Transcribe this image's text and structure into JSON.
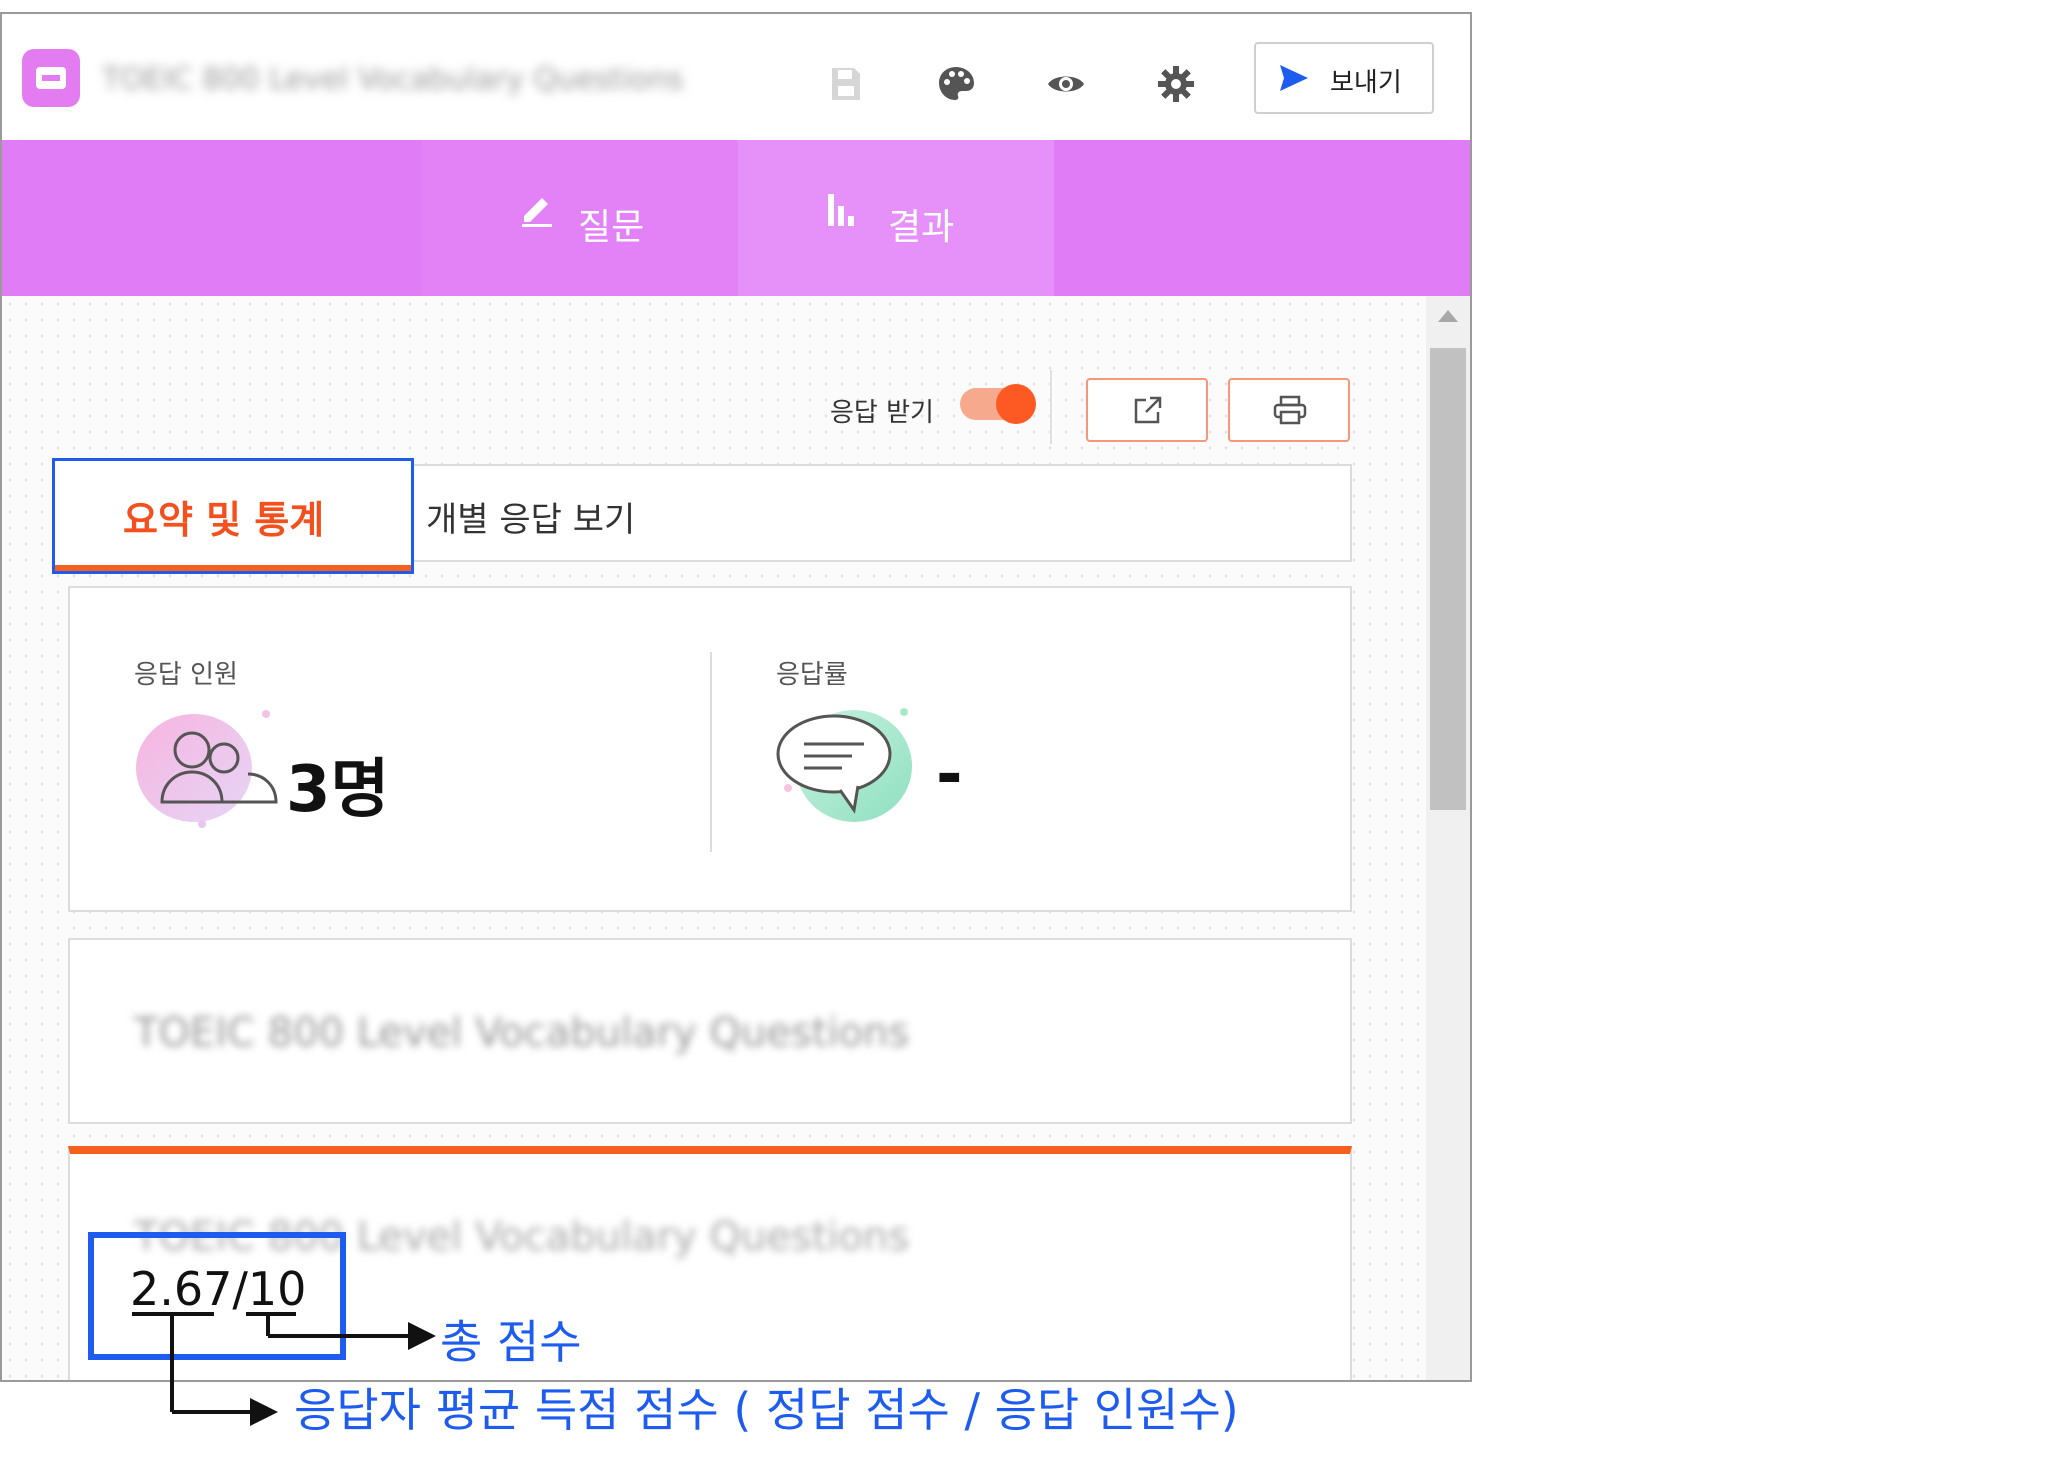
{
  "header": {
    "document_title": "TOEIC 800 Level Vocabulary Questions",
    "send_label": "보내기",
    "icons": [
      "save-icon",
      "palette-icon",
      "eye-icon",
      "gear-icon",
      "send-icon"
    ]
  },
  "tabs": [
    {
      "label": "질문",
      "icon": "pencil-icon"
    },
    {
      "label": "결과",
      "icon": "bar-chart-icon",
      "selected": true
    }
  ],
  "results": {
    "accept_responses_label": "응답 받기",
    "accept_responses_on": true,
    "subtabs": [
      {
        "label": "요약 및 통계",
        "selected": true
      },
      {
        "label": "개별 응답 보기"
      }
    ],
    "respondents_label": "응답 인원",
    "respondents_value": "3명",
    "response_rate_label": "응답률",
    "response_rate_value": "-",
    "question_title": "TOEIC 800 Level Vocabulary Questions",
    "score_section_title": "TOEIC 800 Level Vocabulary Questions",
    "score": "2.67/10"
  },
  "annotations": {
    "total_score": "총 점수",
    "average_score": "응답자 평균 득점 점수 ( 정답 점수 / 응답 인원수)"
  },
  "colors": {
    "purple": "#e07cf6",
    "orange": "#f4601e",
    "annotation_blue": "#1e5cf0"
  }
}
